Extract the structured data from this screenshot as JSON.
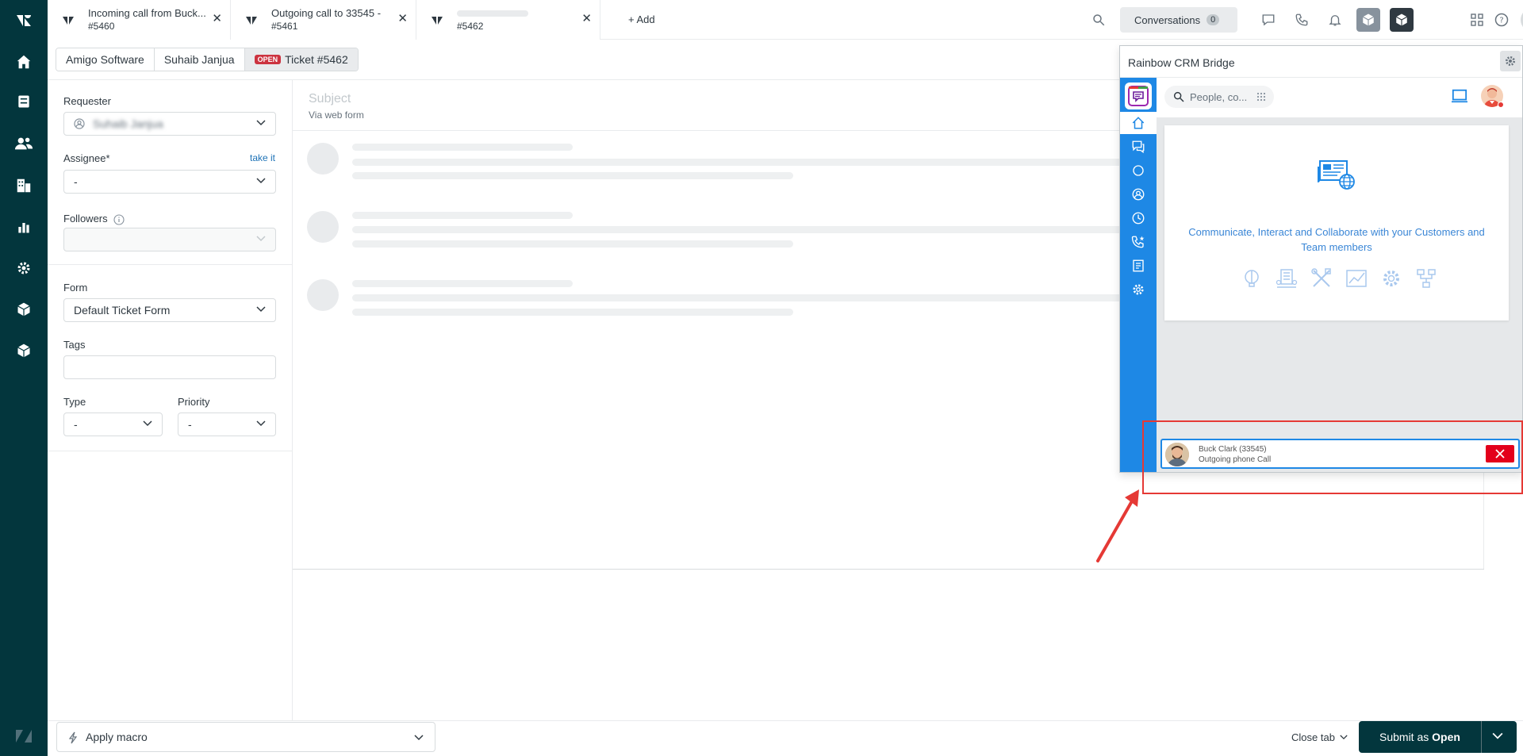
{
  "tabs": [
    {
      "title": "Incoming call from Buck...",
      "sub": "#5460"
    },
    {
      "title": "Outgoing call to 33545 -",
      "sub": "#5461"
    },
    {
      "title": "",
      "sub": "#5462"
    }
  ],
  "add_tab_label": "Add",
  "conversations": {
    "label": "Conversations",
    "count": "0"
  },
  "breadcrumb": {
    "org": "Amigo Software",
    "user": "Suhaib Janjua",
    "status": "OPEN",
    "ticket": "Ticket #5462"
  },
  "form": {
    "requester_label": "Requester",
    "requester_value": "Suhaib Janjua",
    "assignee_label": "Assignee*",
    "take_it": "take it",
    "assignee_value": "-",
    "followers_label": "Followers",
    "form_label": "Form",
    "form_value": "Default Ticket Form",
    "tags_label": "Tags",
    "type_label": "Type",
    "type_value": "-",
    "priority_label": "Priority",
    "priority_value": "-"
  },
  "main": {
    "subject_placeholder": "Subject",
    "via": "Via web form"
  },
  "footer": {
    "macro": "Apply macro",
    "close_tab": "Close tab",
    "submit_prefix": "Submit as ",
    "submit_status": "Open"
  },
  "crm": {
    "title": "Rainbow CRM Bridge",
    "search_placeholder": "People, co...",
    "tagline": "Communicate, Interact and Collaborate with your Customers and Team members",
    "call": {
      "name": "Buck Clark (33545)",
      "status": "Outgoing phone Call"
    }
  },
  "colors": {
    "nav_bg": "#03363d",
    "crm_blue": "#1e88e5",
    "open_badge": "#cc3340",
    "hangup": "#e3001b",
    "annotation": "#e53935"
  }
}
